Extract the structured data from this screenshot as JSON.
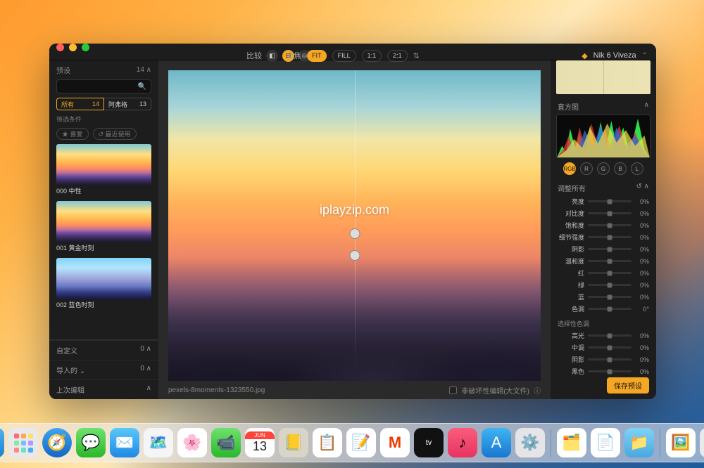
{
  "app": {
    "name": "Nik 6 Viveza"
  },
  "toolbar": {
    "compare": "比较",
    "zoom_label": "变焦",
    "fit": "FIT",
    "fill": "FILL",
    "ratio_1_1": "1:1",
    "ratio_2_1": "2:1"
  },
  "sidebar": {
    "presets_label": "预设",
    "presets_count": "14 ∧",
    "search_placeholder": "",
    "tabs": {
      "all": "所有",
      "all_count": "14",
      "other": "阿弗格",
      "other_count": "13"
    },
    "filter_label": "筛选条件",
    "fav": "★ 喜爱",
    "recent": "↺ 最近使用",
    "thumbs": [
      {
        "label": "000 中性"
      },
      {
        "label": "001 黄金时刻"
      },
      {
        "label": "002 蓝色时刻"
      }
    ],
    "custom": "自定义",
    "custom_count": "0 ∧",
    "import": "导入的 ⌄",
    "import_count": "0 ∧",
    "last_edit": "上次编辑",
    "last_edit_chev": "∧"
  },
  "canvas": {
    "watermark": "iplayzip.com",
    "filename": "pexels-8moments-1323550.jpg",
    "nondestructive": "非破坏性编辑(大文件)",
    "info_icon": "ⓘ"
  },
  "right": {
    "histogram_label": "直方图",
    "channels": {
      "rgb": "RGB",
      "r": "R",
      "g": "G",
      "b": "B",
      "l": "L"
    },
    "adjust_all_label": "调整所有",
    "sliders_main": [
      {
        "label": "亮度",
        "value": "0%"
      },
      {
        "label": "对比度",
        "value": "0%"
      },
      {
        "label": "饱和度",
        "value": "0%"
      },
      {
        "label": "细节强度",
        "value": "0%"
      },
      {
        "label": "阴影",
        "value": "0%"
      },
      {
        "label": "温和度",
        "value": "0%"
      },
      {
        "label": "红",
        "value": "0%"
      },
      {
        "label": "绿",
        "value": "0%"
      },
      {
        "label": "蓝",
        "value": "0%"
      },
      {
        "label": "色调",
        "value": "0°"
      }
    ],
    "selective_label": "选择性色调",
    "sliders_sel": [
      {
        "label": "高光",
        "value": "0%"
      },
      {
        "label": "中调",
        "value": "0%"
      },
      {
        "label": "阴影",
        "value": "0%"
      },
      {
        "label": "黑色",
        "value": "0%"
      }
    ],
    "save_preset": "保存预设"
  },
  "dock": {
    "calendar": {
      "month": "JUN",
      "day": "13"
    }
  }
}
